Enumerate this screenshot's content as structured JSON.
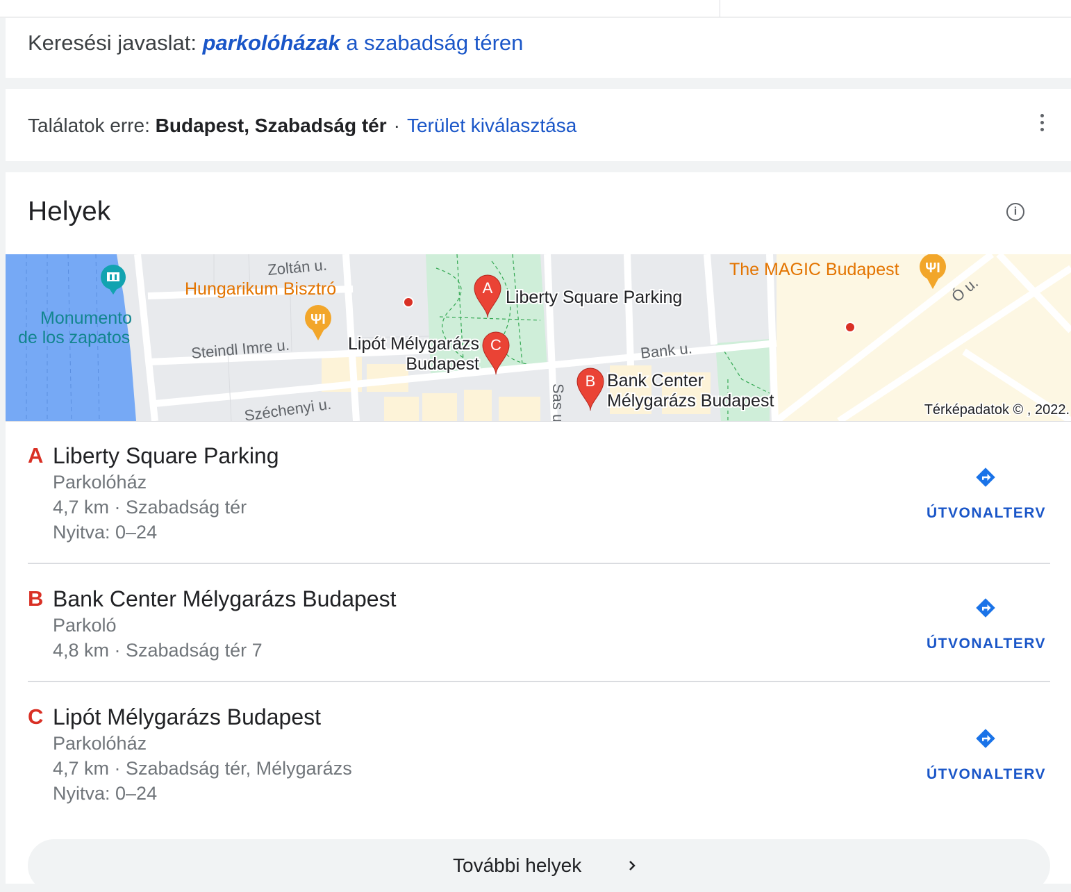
{
  "suggestion": {
    "prefix": "Keresési javaslat:",
    "bold_term": "parkolóházak",
    "rest": "a szabadság téren"
  },
  "results": {
    "prefix": "Találatok erre:",
    "location": "Budapest, Szabadság tér",
    "separator": "·",
    "area_link": "Terület kiválasztása"
  },
  "places": {
    "title": "Helyek",
    "info_icon": "info-icon",
    "map": {
      "streets": [
        "Zoltán u.",
        "Steindl Imre u.",
        "Széchenyi u.",
        "Bank u.",
        "Sas u",
        "Ó u."
      ],
      "poi": [
        "Hungarikum Bisztró",
        "Monumento",
        "de los zapatos",
        "The MAGIC Budapest"
      ],
      "markers": [
        {
          "letter": "A",
          "label": "Liberty Square Parking"
        },
        {
          "letter": "C",
          "label_line1": "Lipót Mélygarázs",
          "label_line2": "Budapest"
        },
        {
          "letter": "B",
          "label_line1": "Bank Center",
          "label_line2": "Mélygarázs Budapest"
        }
      ],
      "attribution": "Térképadatok © , 2022."
    },
    "items": [
      {
        "letter": "A",
        "name": "Liberty Square Parking",
        "type": "Parkolóház",
        "distance_address": "4,7 km · Szabadság tér",
        "hours": "Nyitva: 0–24",
        "route_label": "ÚTVONALTERV"
      },
      {
        "letter": "B",
        "name": "Bank Center Mélygarázs Budapest",
        "type": "Parkoló",
        "distance_address": "4,8 km · Szabadság tér 7",
        "route_label": "ÚTVONALTERV"
      },
      {
        "letter": "C",
        "name": "Lipót Mélygarázs Budapest",
        "type": "Parkolóház",
        "distance_address": "4,7 km · Szabadság tér, Mélygarázs",
        "hours": "Nyitva: 0–24",
        "route_label": "ÚTVONALTERV"
      }
    ],
    "more_label": "További helyek"
  },
  "colors": {
    "link": "#1a56c8",
    "marker": "#d93025",
    "poi_orange": "#e8a02a",
    "water": "#76a9f5",
    "park": "#cfeed9"
  }
}
